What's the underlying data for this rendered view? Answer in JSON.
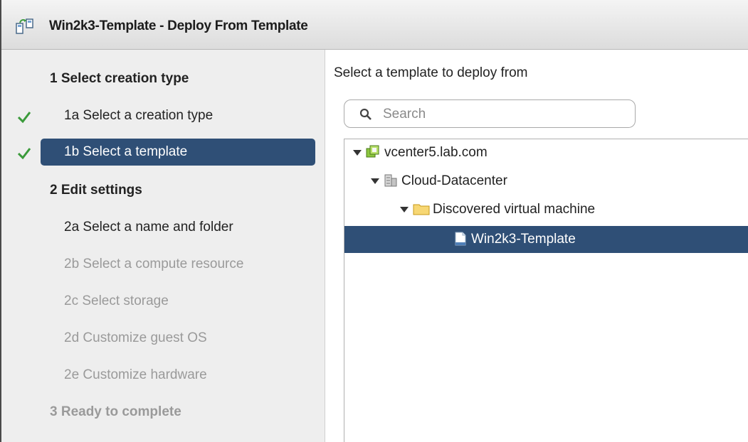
{
  "window": {
    "title": "Win2k3-Template - Deploy From Template"
  },
  "sidebar": {
    "steps": [
      {
        "label": "1  Select creation type",
        "state": "heading"
      },
      {
        "label": "1a  Select a creation type",
        "state": "completed"
      },
      {
        "label": "1b  Select a template",
        "state": "selected"
      },
      {
        "label": "2  Edit settings",
        "state": "heading"
      },
      {
        "label": "2a  Select a name and folder",
        "state": "active"
      },
      {
        "label": "2b  Select a compute resource",
        "state": "disabled"
      },
      {
        "label": "2c  Select storage",
        "state": "disabled"
      },
      {
        "label": "2d  Customize guest OS",
        "state": "disabled"
      },
      {
        "label": "2e  Customize hardware",
        "state": "disabled"
      },
      {
        "label": "3  Ready to complete",
        "state": "disabled-heading"
      }
    ]
  },
  "main": {
    "prompt": "Select a template to deploy from",
    "search": {
      "placeholder": "Search",
      "value": ""
    },
    "tree": [
      {
        "label": "vcenter5.lab.com",
        "icon": "vcenter-icon",
        "expanded": true
      },
      {
        "label": "Cloud-Datacenter",
        "icon": "datacenter-icon",
        "expanded": true
      },
      {
        "label": "Discovered virtual machine",
        "icon": "folder-icon",
        "expanded": true
      },
      {
        "label": "Win2k3-Template",
        "icon": "template-icon",
        "selected": true
      }
    ]
  },
  "colors": {
    "selection": "#2f4f76",
    "check": "#3a9a3a",
    "disabled_text": "#9a9a9a"
  }
}
